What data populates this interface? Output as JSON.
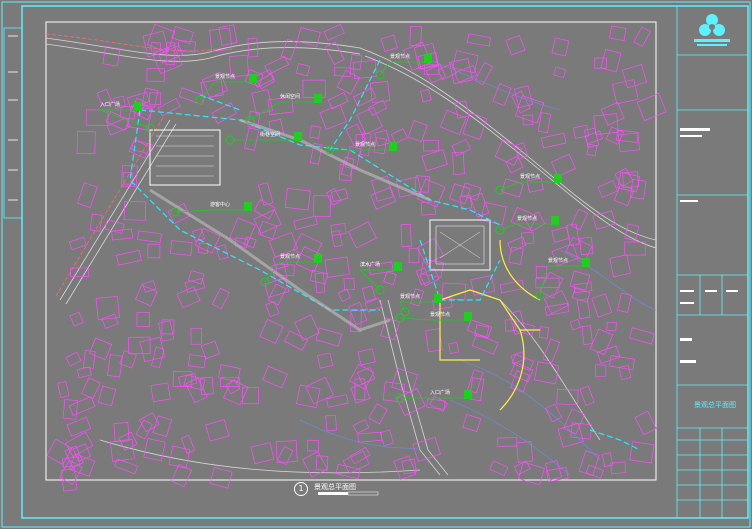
{
  "drawing": {
    "caption_number": "1",
    "caption_text": "景观总平面图",
    "sheet_title": "景观总平面图"
  },
  "callouts": [
    {
      "label": "入口广场"
    },
    {
      "label": "景观节点"
    },
    {
      "label": "休闲空间"
    },
    {
      "label": "景观节点"
    },
    {
      "label": "街巷空间"
    },
    {
      "label": "景观节点"
    },
    {
      "label": "游客中心"
    },
    {
      "label": "景观节点"
    },
    {
      "label": "滨水广场"
    },
    {
      "label": "景观节点"
    },
    {
      "label": "景观节点"
    },
    {
      "label": "景观节点"
    },
    {
      "label": "景观节点"
    },
    {
      "label": "入口广场"
    },
    {
      "label": "景观节点"
    }
  ],
  "colors": {
    "background": "#7a7a7a",
    "frame": "#5df0ff",
    "buildings": "#ff4dff",
    "roads": "#c8c8c8",
    "accent_path": "#2ee6ff",
    "callout": "#22cc22",
    "plaza": "#ffee44"
  }
}
